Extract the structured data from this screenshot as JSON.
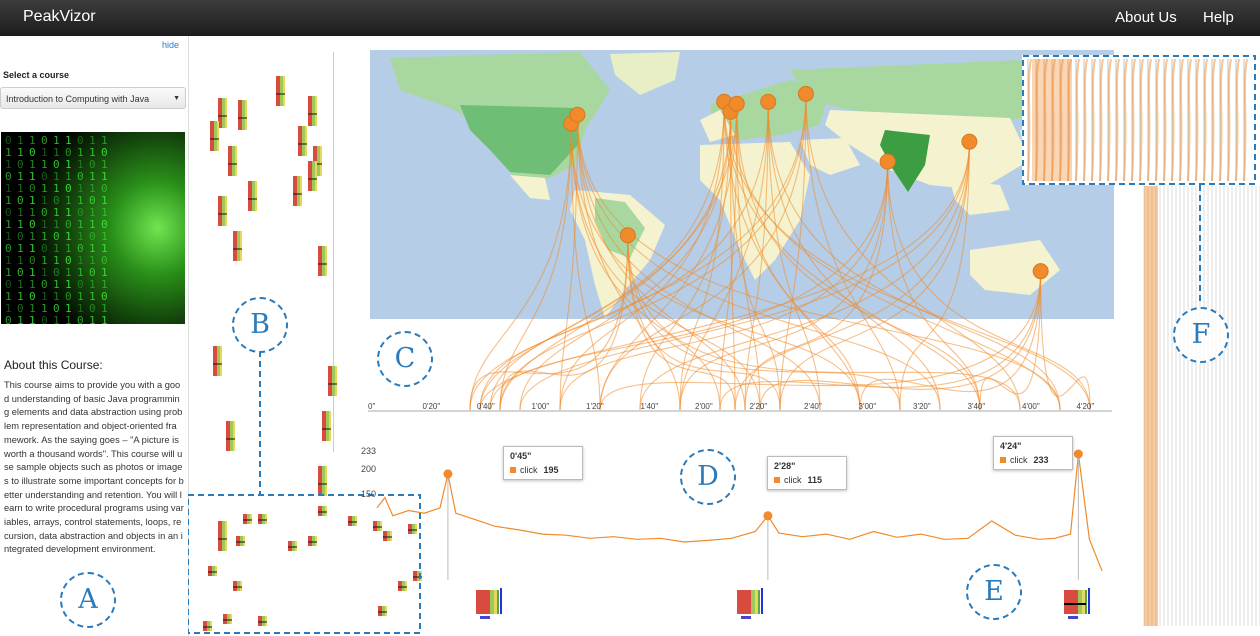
{
  "app": {
    "title": "PeakVizor",
    "nav": {
      "about": "About Us",
      "help": "Help"
    }
  },
  "sidebar": {
    "hide_label": "hide",
    "select_label": "Select a course",
    "course_selected": "Introduction to Computing with Java",
    "about_title": "About this Course:",
    "about_text": "This course aims to provide you with a good understanding of basic Java programming elements and data abstraction using problem representation and object-oriented framework. As the saying goes – \"A picture is worth a thousand words\". This course will use sample objects such as photos or images to illustrate some important concepts for better understanding and retention. You will learn to write procedural programs using variables, arrays, control statements, loops, recursion, data abstraction and objects in an integrated development environment."
  },
  "badges": {
    "A": "A",
    "B": "B",
    "C": "C",
    "D": "D",
    "E": "E",
    "F": "F"
  },
  "flow_axis": {
    "ticks": [
      "0\"",
      "0'20\"",
      "0'40\"",
      "1'00\"",
      "1'20\"",
      "1'40\"",
      "2'00\"",
      "2'20\"",
      "2'40\"",
      "3'00\"",
      "3'20\"",
      "3'40\"",
      "4'00\"",
      "4'20\""
    ]
  },
  "tooltips": [
    {
      "time": "0'45\"",
      "label": "click",
      "value": "195"
    },
    {
      "time": "2'28\"",
      "label": "click",
      "value": "115"
    },
    {
      "time": "4'24\"",
      "label": "click",
      "value": "233"
    }
  ],
  "chart_data": {
    "type": "line",
    "title": "",
    "xlabel": "",
    "ylabel": "",
    "y_ticks": [
      "233",
      "200",
      "150"
    ],
    "x_range_seconds": [
      0,
      290
    ],
    "ylim": [
      0,
      233
    ],
    "series": [
      {
        "name": "click",
        "x": [
          0,
          5,
          10,
          20,
          30,
          40,
          45,
          50,
          60,
          75,
          90,
          105,
          120,
          135,
          150,
          165,
          180,
          195,
          210,
          225,
          240,
          248,
          255,
          270,
          285,
          300,
          315,
          330,
          345,
          360,
          375,
          390,
          405,
          420,
          430,
          440,
          445,
          452,
          460
        ],
        "y": [
          130,
          150,
          115,
          125,
          120,
          130,
          195,
          120,
          110,
          95,
          88,
          80,
          78,
          72,
          75,
          70,
          72,
          65,
          68,
          72,
          85,
          115,
          82,
          75,
          80,
          70,
          85,
          74,
          80,
          70,
          72,
          105,
          78,
          70,
          72,
          80,
          233,
          70,
          10
        ]
      }
    ],
    "peaks": [
      {
        "time": "0'45\"",
        "value": 195
      },
      {
        "time": "2'28\"",
        "value": 115
      },
      {
        "time": "4'24\"",
        "value": 233
      }
    ]
  },
  "map_points": [
    {
      "name": "usa-east",
      "lon": -74,
      "lat": 41
    },
    {
      "name": "canada-east",
      "lon": -71,
      "lat": 45.5
    },
    {
      "name": "brazil",
      "lon": -47,
      "lat": -15
    },
    {
      "name": "uk",
      "lon": -1,
      "lat": 52
    },
    {
      "name": "france",
      "lon": 2,
      "lat": 47
    },
    {
      "name": "netherlands",
      "lon": 5,
      "lat": 51
    },
    {
      "name": "poland",
      "lon": 20,
      "lat": 52
    },
    {
      "name": "russia",
      "lon": 38,
      "lat": 56
    },
    {
      "name": "india",
      "lon": 77,
      "lat": 22
    },
    {
      "name": "china-east",
      "lon": 116,
      "lat": 32
    },
    {
      "name": "australia",
      "lon": 150,
      "lat": -33
    }
  ],
  "colors": {
    "accent": "#f08a2a",
    "badge": "#2b7bbb",
    "ocean": "#b5cde6",
    "land": "#f5f3cf"
  }
}
